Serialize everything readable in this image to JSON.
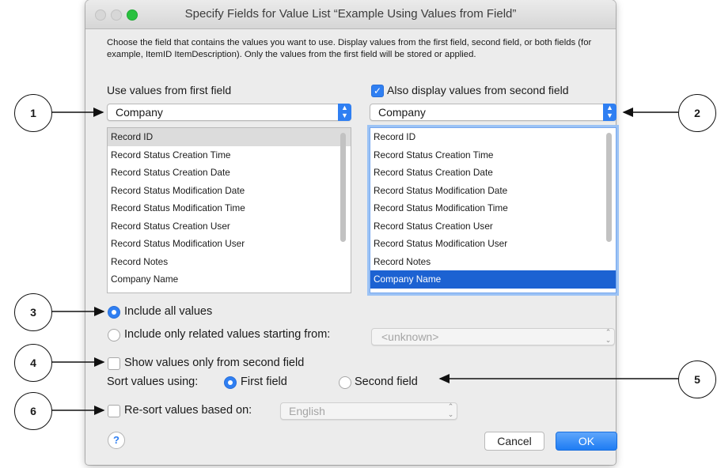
{
  "window": {
    "title": "Specify Fields for Value List “Example Using Values from Field”",
    "colors": {
      "close": "#d7d7d7",
      "minimize": "#d7d7d7",
      "zoom": "#29c13f",
      "accent": "#2f7ff2",
      "selection": "#1c62d2"
    }
  },
  "description": "Choose the field that contains the values you want to use.  Display values from the first field, second field, or both fields (for example, ItemID ItemDescription). Only the values from the first field will be stored or applied.",
  "first_field": {
    "heading": "Use values from first field",
    "table": "Company",
    "fields": [
      "Record ID",
      "Record Status Creation Time",
      "Record Status Creation Date",
      "Record Status Modification Date",
      "Record Status Modification Time",
      "Record Status Creation User",
      "Record Status Modification User",
      "Record Notes",
      "Company Name"
    ],
    "selected": "Record ID"
  },
  "second_field": {
    "checkbox_label": "Also display values from second field",
    "checked": true,
    "table": "Company",
    "fields": [
      "Record ID",
      "Record Status Creation Time",
      "Record Status Creation Date",
      "Record Status Modification Date",
      "Record Status Modification Time",
      "Record Status Creation User",
      "Record Status Modification User",
      "Record Notes",
      "Company Name"
    ],
    "selected": "Company Name"
  },
  "include": {
    "all_label": "Include all values",
    "related_label": "Include only related values starting from:",
    "related_value": "<unknown>",
    "selected": "all"
  },
  "show_second_only": {
    "label": "Show values only from second field",
    "checked": false
  },
  "sort": {
    "label": "Sort values using:",
    "first_label": "First field",
    "second_label": "Second field",
    "selected": "first"
  },
  "resort": {
    "label": "Re-sort values based on:",
    "checked": false,
    "language": "English"
  },
  "buttons": {
    "help": "?",
    "cancel": "Cancel",
    "ok": "OK"
  },
  "callouts": [
    "1",
    "2",
    "3",
    "4",
    "5",
    "6"
  ]
}
